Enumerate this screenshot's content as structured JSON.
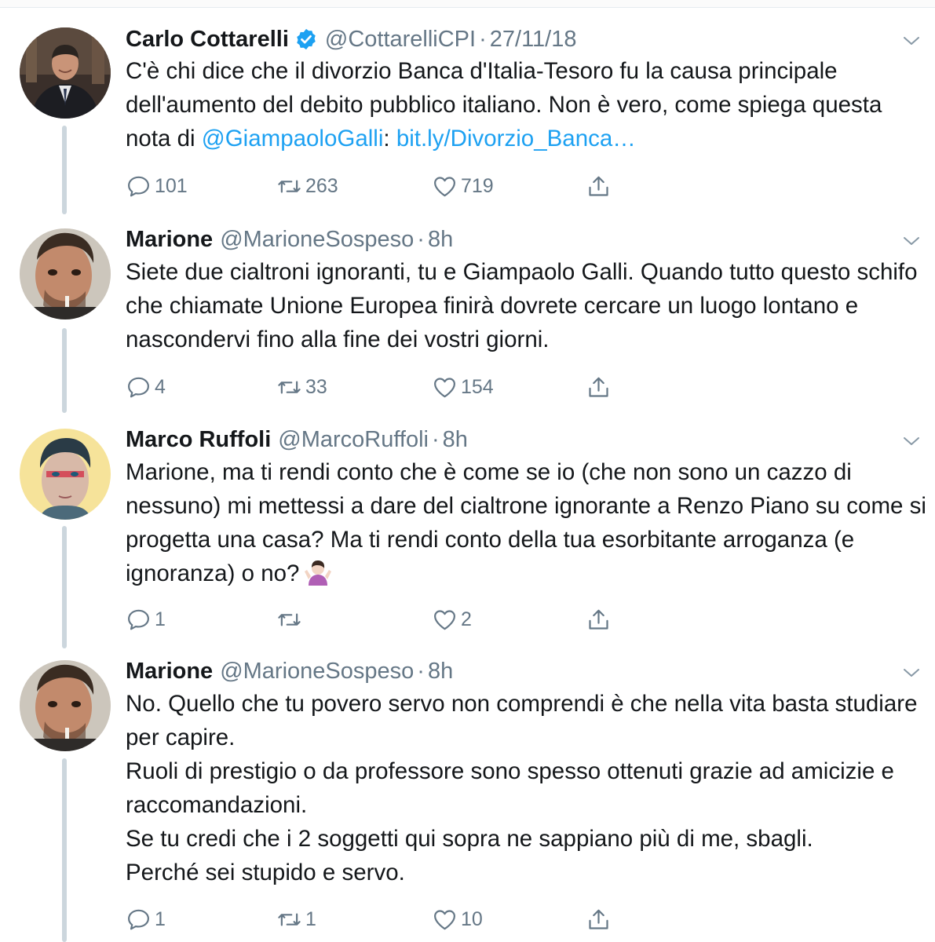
{
  "colors": {
    "text": "#14171a",
    "muted": "#657786",
    "link": "#1da1f2",
    "verified": "#1da1f2",
    "thread_line": "#ccd6dd"
  },
  "tweets": [
    {
      "name": "Carlo Cottarelli",
      "verified": true,
      "handle": "@CottarelliCPI",
      "time": "27/11/18",
      "text_pre": "C'è chi dice che il divorzio Banca d'Italia-Tesoro fu la causa principale dell'aumento del debito pubblico italiano. Non è vero, come spiega questa nota di ",
      "mention": "@GiampaoloGalli",
      "text_mid": ": ",
      "link": "bit.ly/Divorzio_Banca…",
      "replies": "101",
      "retweets": "263",
      "likes": "719"
    },
    {
      "name": "Marione",
      "handle": "@MarioneSospeso",
      "time": "8h",
      "text": "Siete due cialtroni ignoranti, tu e Giampaolo Galli. Quando tutto questo schifo che chiamate Unione Europea finirà dovrete cercare un luogo lontano e nascondervi fino alla fine dei vostri giorni.",
      "replies": "4",
      "retweets": "33",
      "likes": "154"
    },
    {
      "name": "Marco Ruffoli",
      "handle": "@MarcoRuffoli",
      "time": "8h",
      "text": "Marione, ma ti rendi conto che è come se io (che non sono un cazzo di nessuno) mi mettessi a dare del cialtrone ignorante a Renzo Piano su come si progetta una casa? Ma ti rendi conto della tua esorbitante arroganza (e ignoranza) o no?",
      "emoji": "person-shrugging-emoji",
      "replies": "1",
      "retweets": "",
      "likes": "2"
    },
    {
      "name": "Marione",
      "handle": "@MarioneSospeso",
      "time": "8h",
      "lines": [
        "No. Quello che tu povero servo non comprendi è che nella vita basta studiare per capire.",
        "Ruoli di prestigio o da professore sono spesso ottenuti grazie ad amicizie e raccomandazioni.",
        "Se tu credi che i 2 soggetti qui sopra ne sappiano più di me, sbagli.",
        "Perché sei stupido e servo."
      ],
      "replies": "1",
      "retweets": "1",
      "likes": "10"
    }
  ],
  "dot": "·",
  "icons": [
    "verified-icon",
    "chevron-down-icon",
    "reply-icon",
    "retweet-icon",
    "like-icon",
    "share-icon"
  ]
}
